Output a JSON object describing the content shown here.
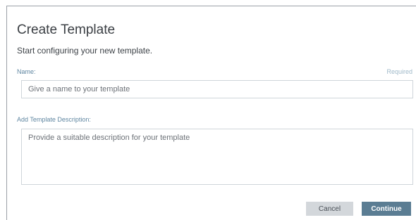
{
  "dialog": {
    "title": "Create Template",
    "subtitle": "Start configuring your new template."
  },
  "name_field": {
    "label": "Name:",
    "required_text": "Required",
    "placeholder": "Give a name to your template",
    "value": ""
  },
  "description_field": {
    "label": "Add Template Description:",
    "placeholder": "Provide a suitable description for your template",
    "value": ""
  },
  "actions": {
    "cancel_label": "Cancel",
    "continue_label": "Continue"
  },
  "colors": {
    "label": "#5f86a1",
    "required": "#9fb9c9",
    "continue_bg": "#5b7d93",
    "cancel_bg": "#d3d7db"
  }
}
